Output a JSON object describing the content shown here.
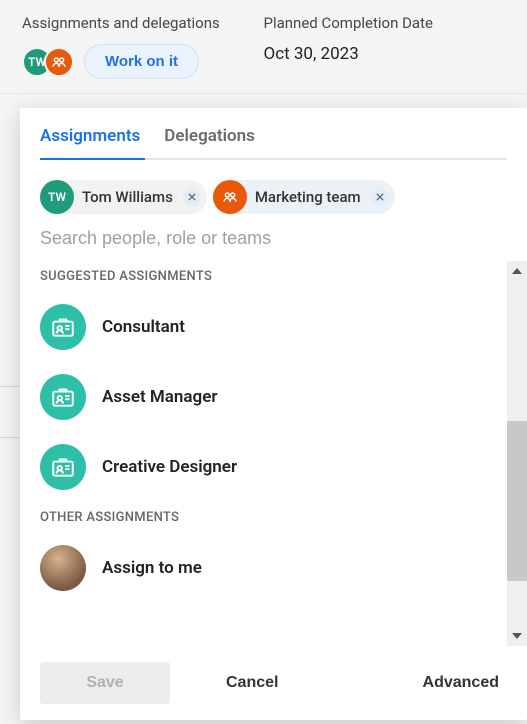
{
  "header": {
    "assignments_label": "Assignments and delegations",
    "planned_completion_label": "Planned Completion Date",
    "planned_completion_value": "Oct 30, 2023",
    "work_on_it_label": "Work on it",
    "avatar1_initials": "TW"
  },
  "popover": {
    "tabs": {
      "assignments": "Assignments",
      "delegations": "Delegations"
    },
    "chips": {
      "user": {
        "initials": "TW",
        "name": "Tom Williams"
      },
      "team": {
        "name": "Marketing team"
      }
    },
    "search_placeholder": "Search people, role or teams",
    "sections": {
      "suggested": "SUGGESTED ASSIGNMENTS",
      "other": "OTHER ASSIGNMENTS"
    },
    "suggested_items": [
      {
        "label": "Consultant"
      },
      {
        "label": "Asset Manager"
      },
      {
        "label": "Creative Designer"
      }
    ],
    "other_items": [
      {
        "label": "Assign to me"
      }
    ],
    "footer": {
      "save": "Save",
      "cancel": "Cancel",
      "advanced": "Advanced"
    }
  }
}
